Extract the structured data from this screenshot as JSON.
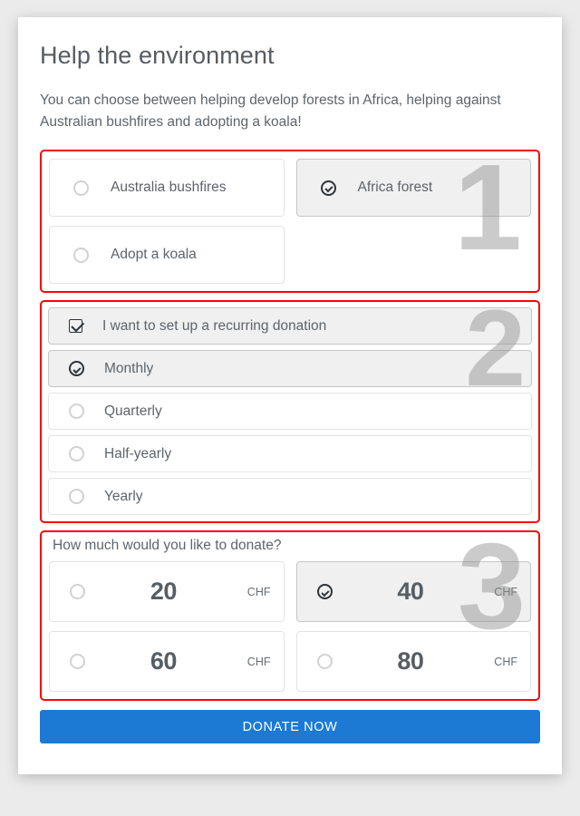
{
  "header": {
    "title": "Help the environment",
    "description": "You can choose between helping develop forests in Africa, helping against Australian bushfires and adopting a koala!"
  },
  "section1": {
    "watermark": "1",
    "options": [
      {
        "label": "Australia bushfires",
        "selected": false
      },
      {
        "label": "Africa forest",
        "selected": true
      },
      {
        "label": "Adopt a koala",
        "selected": false
      }
    ]
  },
  "section2": {
    "watermark": "2",
    "checkbox": {
      "label": "I want to set up a recurring donation",
      "checked": true
    },
    "options": [
      {
        "label": "Monthly",
        "selected": true
      },
      {
        "label": "Quarterly",
        "selected": false
      },
      {
        "label": "Half-yearly",
        "selected": false
      },
      {
        "label": "Yearly",
        "selected": false
      }
    ]
  },
  "section3": {
    "watermark": "3",
    "label": "How much would you like to donate?",
    "currency": "CHF",
    "amounts": [
      {
        "value": "20",
        "selected": false
      },
      {
        "value": "40",
        "selected": true
      },
      {
        "value": "60",
        "selected": false
      },
      {
        "value": "80",
        "selected": false
      }
    ]
  },
  "footer": {
    "donate_label": "DONATE NOW"
  },
  "colors": {
    "accent": "#1c7ad4",
    "annotation": "#fa0505",
    "text": "#5d646b",
    "selected_fill": "#f0f0f0",
    "watermark": "#8c8c8c"
  }
}
